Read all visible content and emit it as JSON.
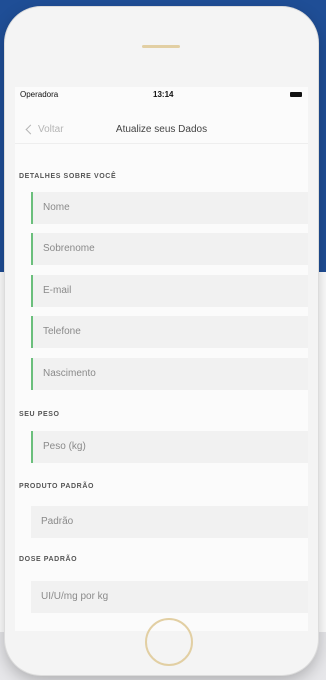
{
  "status_bar": {
    "carrier": "Operadora",
    "time": "13:14"
  },
  "nav": {
    "back_label": "Voltar",
    "title": "Atualize seus Dados"
  },
  "sections": {
    "details": "DETALHES SOBRE VOCÊ",
    "weight": "SEU PESO",
    "product": "PRODUTO PADRÃO",
    "dose": "DOSE PADRÃO"
  },
  "fields": {
    "first_name": "Nome",
    "last_name": "Sobrenome",
    "email": "E-mail",
    "phone": "Telefone",
    "birth": "Nascimento",
    "weight": "Peso (kg)",
    "product": "Padrão",
    "dose": "UI/U/mg por kg"
  },
  "colors": {
    "background_blue": "#1f4e96",
    "accent_green": "#6bbf7c",
    "hardware_gold": "#e2cfa3"
  }
}
